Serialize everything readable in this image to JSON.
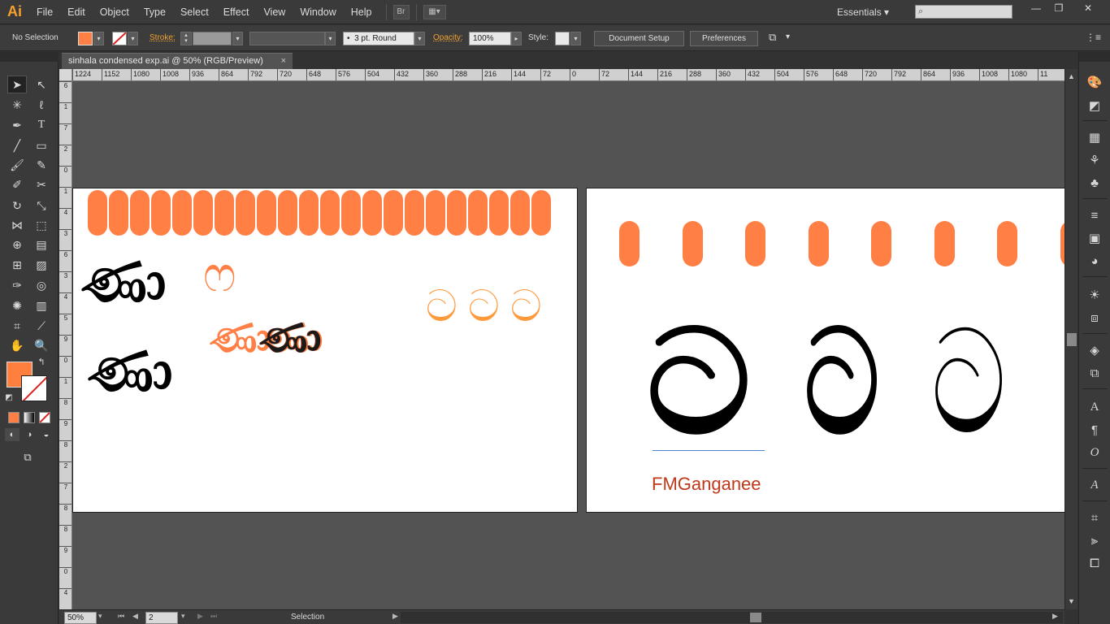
{
  "app": {
    "logo": "Ai",
    "workspace": "Essentials"
  },
  "menu": [
    "File",
    "Edit",
    "Object",
    "Type",
    "Select",
    "Effect",
    "View",
    "Window",
    "Help"
  ],
  "menubar_buttons": {
    "bridge": "Br",
    "arrange": "▦▾"
  },
  "window_controls": {
    "minimize": "—",
    "restore": "❐",
    "close": "✕"
  },
  "controlbar": {
    "selection": "No Selection",
    "stroke_label": "Stroke:",
    "brush": "3 pt. Round",
    "opacity_label": "Opacity:",
    "opacity_value": "100%",
    "style_label": "Style:",
    "document_setup": "Document Setup",
    "preferences": "Preferences"
  },
  "document": {
    "tab_title": "sinhala condensed exp.ai @ 50% (RGB/Preview)",
    "close": "×"
  },
  "ruler_h": [
    "1224",
    "1152",
    "1080",
    "1008",
    "936",
    "864",
    "792",
    "720",
    "648",
    "576",
    "504",
    "432",
    "360",
    "288",
    "216",
    "144",
    "72",
    "0",
    "72",
    "144",
    "216",
    "288",
    "360",
    "432",
    "504",
    "576",
    "648",
    "720",
    "792",
    "864",
    "936",
    "1008",
    "1080",
    "11"
  ],
  "ruler_v": [
    "6",
    "1",
    "7",
    "2",
    "0",
    "1",
    "4",
    "3",
    "6",
    "3",
    "4",
    "5",
    "9",
    "0",
    "1",
    "8",
    "9",
    "8",
    "2",
    "7",
    "8",
    "8",
    "9",
    "0",
    "4"
  ],
  "artboard1": {
    "glyph_black_1": "ණා",
    "glyph_black_2": "ණා",
    "glyph_outline": "ෆ",
    "glyph_orange": "ණා",
    "glyph_striped": "ණා",
    "glyph_row": "ට ට ට"
  },
  "artboard2": {
    "glyph_1": "ට",
    "glyph_2": "ට",
    "glyph_3": "ට",
    "font_name": "FMGanganee"
  },
  "colors": {
    "fill": "#ff7f45",
    "accent": "#f7a02d",
    "font_label": "#c0391b"
  },
  "statusbar": {
    "zoom": "50%",
    "artboard": "2",
    "tool": "Selection"
  }
}
